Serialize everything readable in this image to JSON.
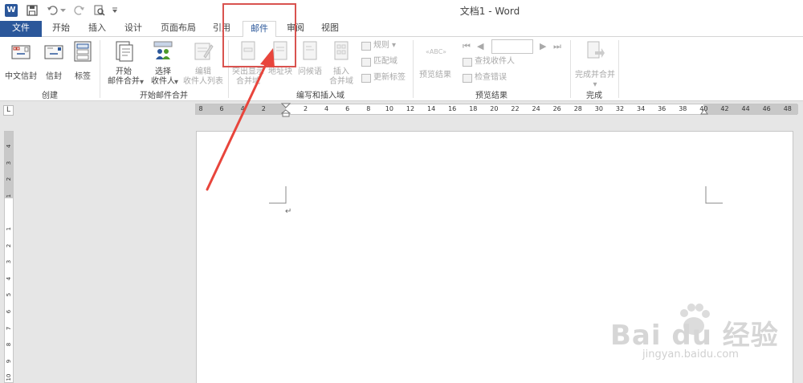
{
  "window": {
    "title": "文档1 - Word",
    "app_icon_letter": "W"
  },
  "tabs": [
    {
      "id": "file",
      "label": "文件"
    },
    {
      "id": "home",
      "label": "开始"
    },
    {
      "id": "insert",
      "label": "插入"
    },
    {
      "id": "design",
      "label": "设计"
    },
    {
      "id": "layout",
      "label": "页面布局"
    },
    {
      "id": "references",
      "label": "引用"
    },
    {
      "id": "mailings",
      "label": "邮件",
      "active": true
    },
    {
      "id": "review",
      "label": "审阅"
    },
    {
      "id": "view",
      "label": "视图"
    }
  ],
  "ribbon": {
    "groups": {
      "create": "创建",
      "start_merge": "开始邮件合并",
      "write_insert": "编写和插入域",
      "preview": "预览结果",
      "finish": "完成"
    },
    "create": {
      "chinese_envelope": "中文信封",
      "envelope": "信封",
      "label": "标签"
    },
    "start_merge": {
      "start_line1": "开始",
      "start_line2": "邮件合并",
      "select_line1": "选择",
      "select_line2": "收件人",
      "edit_line1": "编辑",
      "edit_line2": "收件人列表"
    },
    "write_insert": {
      "highlight_line1": "突出显示",
      "highlight_line2": "合并域",
      "address_block": "地址块",
      "greeting": "问候语",
      "insert_line1": "插入",
      "insert_line2": "合并域",
      "rules": "规则",
      "match_fields": "匹配域",
      "update_labels": "更新标签"
    },
    "preview": {
      "preview_results": "预览结果",
      "record_value": "",
      "find_recipient": "查找收件人",
      "check_errors": "检查错误"
    },
    "finish": {
      "finish_merge": "完成并合并"
    }
  },
  "ruler": {
    "h_numbers": [
      "8",
      "6",
      "4",
      "2",
      "",
      "2",
      "4",
      "6",
      "8",
      "10",
      "12",
      "14",
      "16",
      "18",
      "20",
      "22",
      "24",
      "26",
      "28",
      "30",
      "32",
      "34",
      "36",
      "38",
      "40",
      "42",
      "44",
      "46",
      "48"
    ],
    "v_numbers": [
      "4",
      "3",
      "2",
      "1",
      "",
      "1",
      "2",
      "3",
      "4",
      "5",
      "6",
      "7",
      "8",
      "9",
      "10"
    ],
    "corner": "L"
  },
  "document": {
    "paragraph_mark": "↵"
  },
  "watermark": {
    "line1": "Bai du 经验",
    "line2": "jingyan.baidu.com"
  },
  "colors": {
    "accent": "#2b579a",
    "annotation": "#d9534f"
  }
}
